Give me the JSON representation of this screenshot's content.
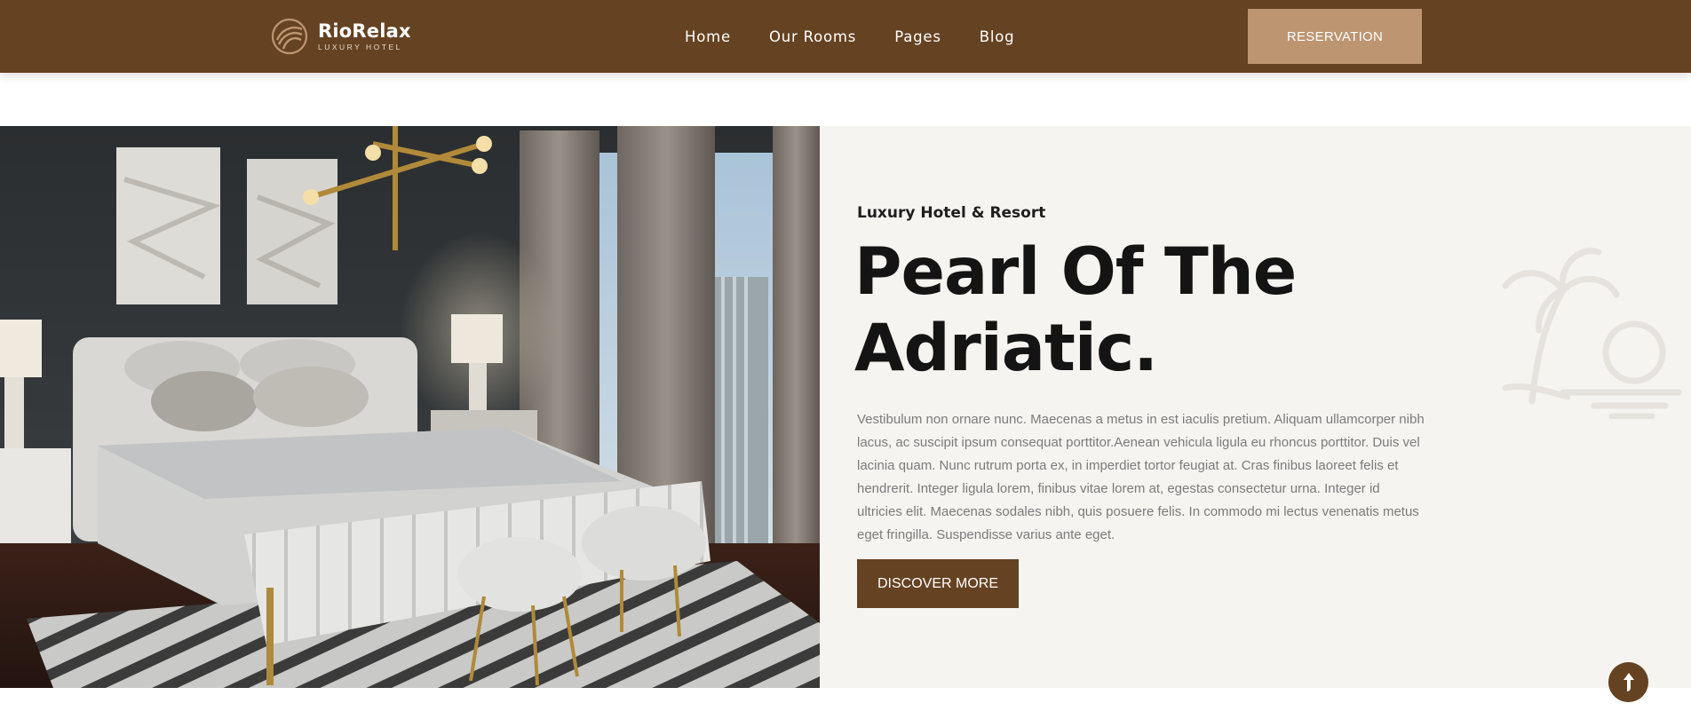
{
  "header": {
    "brand_name": "RioRelax",
    "brand_tagline": "LUXURY HOTEL",
    "logo_icon": "wave-palm-logo-icon",
    "nav": [
      {
        "label": "Home"
      },
      {
        "label": "Our Rooms"
      },
      {
        "label": "Pages"
      },
      {
        "label": "Blog"
      }
    ],
    "reservation_label": "RESERVATION"
  },
  "hero": {
    "eyebrow": "Luxury Hotel & Resort",
    "title_line1": "Pearl Of The",
    "title_line2": "Adriatic.",
    "description": "Vestibulum non ornare nunc. Maecenas a metus in est iaculis pretium. Aliquam ullamcorper nibh lacus, ac suscipit ipsum consequat porttitor.Aenean vehicula ligula eu rhoncus porttitor. Duis vel lacinia quam. Nunc rutrum porta ex, in imperdiet tortor feugiat at. Cras finibus laoreet felis et hendrerit. Integer ligula lorem, finibus vitae lorem at, egestas consectetur urna. Integer id ultricies elit. Maecenas sodales nibh, quis posuere felis. In commodo mi lectus venenatis metus eget fringilla. Suspendisse varius ante eget.",
    "cta_label": "DISCOVER MORE",
    "image_alt": "Luxury bedroom with bed, chandelier and city view",
    "decor_icon": "palm-sunset-icon"
  },
  "scroll_top_icon": "arrow-up-icon",
  "colors": {
    "brand_brown": "#654222",
    "reservation_tan": "#bd9571",
    "hero_background": "#f5f4f1",
    "heading_text": "#141414",
    "body_text": "#7b7b7b"
  }
}
